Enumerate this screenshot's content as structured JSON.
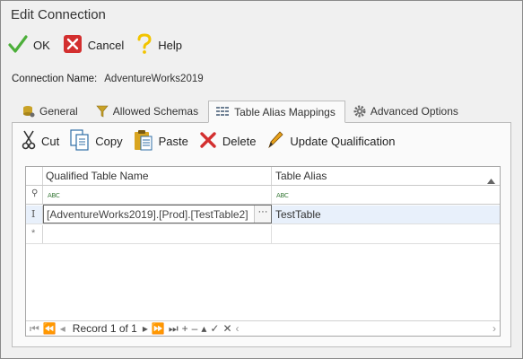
{
  "window": {
    "title": "Edit Connection"
  },
  "toolbar": {
    "ok_label": "OK",
    "cancel_label": "Cancel",
    "help_label": "Help"
  },
  "connection": {
    "name_label": "Connection Name:",
    "name_value": "AdventureWorks2019"
  },
  "tabs": [
    {
      "label": "General",
      "icon": "database-gear-icon"
    },
    {
      "label": "Allowed Schemas",
      "icon": "filter-icon"
    },
    {
      "label": "Table Alias Mappings",
      "icon": "grid-icon",
      "active": true
    },
    {
      "label": "Advanced Options",
      "icon": "gear-icon"
    }
  ],
  "panel_toolbar": {
    "cut_label": "Cut",
    "copy_label": "Copy",
    "paste_label": "Paste",
    "delete_label": "Delete",
    "update_label": "Update Qualification"
  },
  "grid": {
    "columns": [
      "Qualified Table Name",
      "Table Alias"
    ],
    "filter_glyph": "ABC",
    "rows": [
      {
        "qualified_name": "[AdventureWorks2019].[Prod].[TestTable2]",
        "alias": "TestTable",
        "ellipsis": "···",
        "indicator": "I"
      }
    ],
    "new_row_indicator": "*",
    "filter_row_indicator": "⚲"
  },
  "navigator": {
    "record_text": "Record 1 of 1"
  },
  "colors": {
    "ok_green": "#4caf3a",
    "cancel_red": "#d32f2f",
    "help_yellow": "#f2c400",
    "selected_row": "#e8f0fb"
  }
}
